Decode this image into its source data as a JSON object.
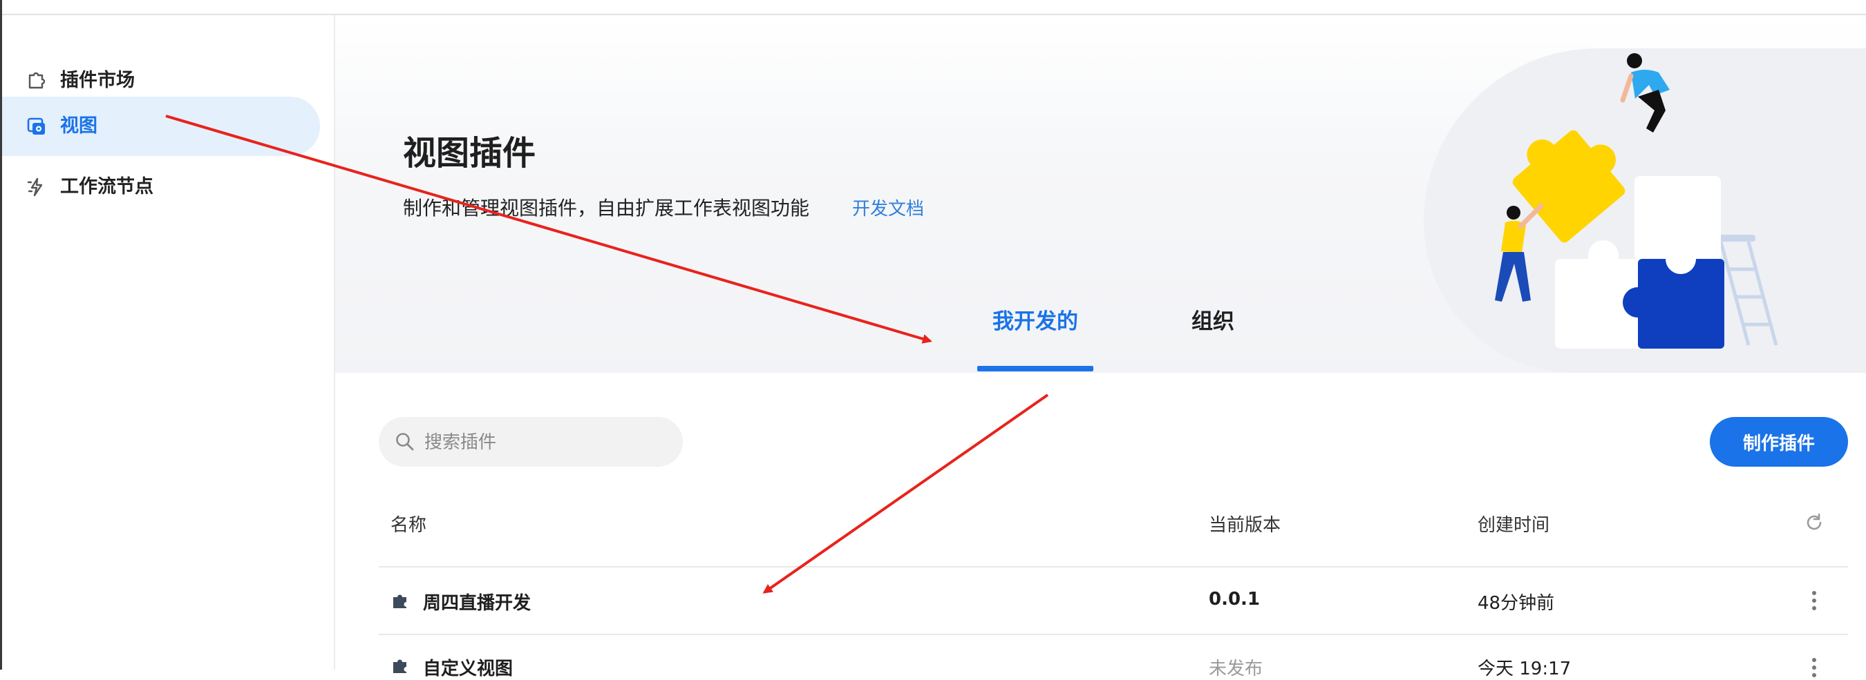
{
  "sidebar": {
    "items": [
      {
        "label": "插件市场",
        "icon": "puzzle-outline-icon"
      },
      {
        "label": "视图",
        "icon": "view-icon",
        "active": true
      },
      {
        "label": "工作流节点",
        "icon": "workflow-icon"
      }
    ]
  },
  "hero": {
    "title": "视图插件",
    "description": "制作和管理视图插件，自由扩展工作表视图功能",
    "doc_link": "开发文档"
  },
  "tabs": [
    {
      "label": "我开发的",
      "active": true
    },
    {
      "label": "组织",
      "active": false
    }
  ],
  "search": {
    "placeholder": "搜索插件",
    "value": ""
  },
  "make_button": "制作插件",
  "table": {
    "headers": {
      "name": "名称",
      "version": "当前版本",
      "created": "创建时间"
    },
    "rows": [
      {
        "name": "周四直播开发",
        "version": "0.0.1",
        "created": "48分钟前"
      },
      {
        "name": "自定义视图",
        "version": "未发布",
        "created": "今天 19:17"
      }
    ]
  },
  "colors": {
    "accent": "#1a73e8",
    "annotation": "#e8231c"
  }
}
